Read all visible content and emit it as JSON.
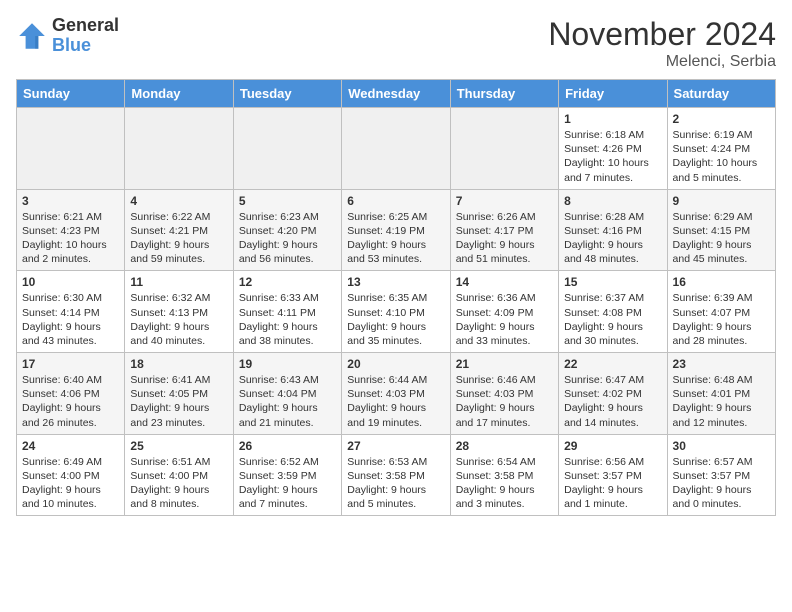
{
  "header": {
    "logo_general": "General",
    "logo_blue": "Blue",
    "month": "November 2024",
    "location": "Melenci, Serbia"
  },
  "days_of_week": [
    "Sunday",
    "Monday",
    "Tuesday",
    "Wednesday",
    "Thursday",
    "Friday",
    "Saturday"
  ],
  "weeks": [
    [
      {
        "day": "",
        "info": ""
      },
      {
        "day": "",
        "info": ""
      },
      {
        "day": "",
        "info": ""
      },
      {
        "day": "",
        "info": ""
      },
      {
        "day": "",
        "info": ""
      },
      {
        "day": "1",
        "info": "Sunrise: 6:18 AM\nSunset: 4:26 PM\nDaylight: 10 hours and 7 minutes."
      },
      {
        "day": "2",
        "info": "Sunrise: 6:19 AM\nSunset: 4:24 PM\nDaylight: 10 hours and 5 minutes."
      }
    ],
    [
      {
        "day": "3",
        "info": "Sunrise: 6:21 AM\nSunset: 4:23 PM\nDaylight: 10 hours and 2 minutes."
      },
      {
        "day": "4",
        "info": "Sunrise: 6:22 AM\nSunset: 4:21 PM\nDaylight: 9 hours and 59 minutes."
      },
      {
        "day": "5",
        "info": "Sunrise: 6:23 AM\nSunset: 4:20 PM\nDaylight: 9 hours and 56 minutes."
      },
      {
        "day": "6",
        "info": "Sunrise: 6:25 AM\nSunset: 4:19 PM\nDaylight: 9 hours and 53 minutes."
      },
      {
        "day": "7",
        "info": "Sunrise: 6:26 AM\nSunset: 4:17 PM\nDaylight: 9 hours and 51 minutes."
      },
      {
        "day": "8",
        "info": "Sunrise: 6:28 AM\nSunset: 4:16 PM\nDaylight: 9 hours and 48 minutes."
      },
      {
        "day": "9",
        "info": "Sunrise: 6:29 AM\nSunset: 4:15 PM\nDaylight: 9 hours and 45 minutes."
      }
    ],
    [
      {
        "day": "10",
        "info": "Sunrise: 6:30 AM\nSunset: 4:14 PM\nDaylight: 9 hours and 43 minutes."
      },
      {
        "day": "11",
        "info": "Sunrise: 6:32 AM\nSunset: 4:13 PM\nDaylight: 9 hours and 40 minutes."
      },
      {
        "day": "12",
        "info": "Sunrise: 6:33 AM\nSunset: 4:11 PM\nDaylight: 9 hours and 38 minutes."
      },
      {
        "day": "13",
        "info": "Sunrise: 6:35 AM\nSunset: 4:10 PM\nDaylight: 9 hours and 35 minutes."
      },
      {
        "day": "14",
        "info": "Sunrise: 6:36 AM\nSunset: 4:09 PM\nDaylight: 9 hours and 33 minutes."
      },
      {
        "day": "15",
        "info": "Sunrise: 6:37 AM\nSunset: 4:08 PM\nDaylight: 9 hours and 30 minutes."
      },
      {
        "day": "16",
        "info": "Sunrise: 6:39 AM\nSunset: 4:07 PM\nDaylight: 9 hours and 28 minutes."
      }
    ],
    [
      {
        "day": "17",
        "info": "Sunrise: 6:40 AM\nSunset: 4:06 PM\nDaylight: 9 hours and 26 minutes."
      },
      {
        "day": "18",
        "info": "Sunrise: 6:41 AM\nSunset: 4:05 PM\nDaylight: 9 hours and 23 minutes."
      },
      {
        "day": "19",
        "info": "Sunrise: 6:43 AM\nSunset: 4:04 PM\nDaylight: 9 hours and 21 minutes."
      },
      {
        "day": "20",
        "info": "Sunrise: 6:44 AM\nSunset: 4:03 PM\nDaylight: 9 hours and 19 minutes."
      },
      {
        "day": "21",
        "info": "Sunrise: 6:46 AM\nSunset: 4:03 PM\nDaylight: 9 hours and 17 minutes."
      },
      {
        "day": "22",
        "info": "Sunrise: 6:47 AM\nSunset: 4:02 PM\nDaylight: 9 hours and 14 minutes."
      },
      {
        "day": "23",
        "info": "Sunrise: 6:48 AM\nSunset: 4:01 PM\nDaylight: 9 hours and 12 minutes."
      }
    ],
    [
      {
        "day": "24",
        "info": "Sunrise: 6:49 AM\nSunset: 4:00 PM\nDaylight: 9 hours and 10 minutes."
      },
      {
        "day": "25",
        "info": "Sunrise: 6:51 AM\nSunset: 4:00 PM\nDaylight: 9 hours and 8 minutes."
      },
      {
        "day": "26",
        "info": "Sunrise: 6:52 AM\nSunset: 3:59 PM\nDaylight: 9 hours and 7 minutes."
      },
      {
        "day": "27",
        "info": "Sunrise: 6:53 AM\nSunset: 3:58 PM\nDaylight: 9 hours and 5 minutes."
      },
      {
        "day": "28",
        "info": "Sunrise: 6:54 AM\nSunset: 3:58 PM\nDaylight: 9 hours and 3 minutes."
      },
      {
        "day": "29",
        "info": "Sunrise: 6:56 AM\nSunset: 3:57 PM\nDaylight: 9 hours and 1 minute."
      },
      {
        "day": "30",
        "info": "Sunrise: 6:57 AM\nSunset: 3:57 PM\nDaylight: 9 hours and 0 minutes."
      }
    ]
  ]
}
